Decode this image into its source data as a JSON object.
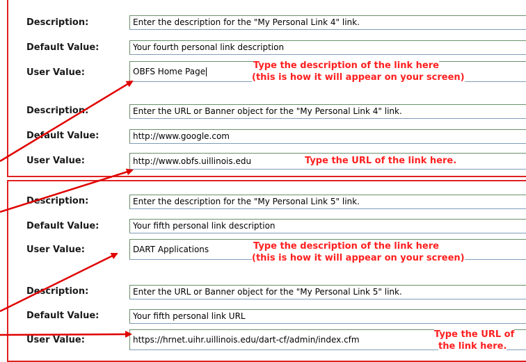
{
  "labels": {
    "description": "Description:",
    "default_value": "Default Value:",
    "user_value": "User Value:"
  },
  "link4": {
    "name_description": "Enter the description for the \"My Personal Link 4\" link.",
    "name_default": "Your fourth personal link description",
    "name_user": "OBFS Home Page",
    "url_description": "Enter the URL or Banner object for the \"My Personal Link 4\" link.",
    "url_default": "http://www.google.com",
    "url_user": "http://www.obfs.uillinois.edu"
  },
  "link5": {
    "name_description": "Enter the description for the \"My Personal Link 5\" link.",
    "name_default": "Your fifth personal link description",
    "name_user": "DART Applications",
    "url_description": "Enter the URL or Banner object for the \"My Personal Link 5\" link.",
    "url_default": "Your fifth personal link URL",
    "url_user": "https://hrnet.uihr.uillinois.edu/dart-cf/admin/index.cfm"
  },
  "notes": {
    "desc_line1": "Type the description of the link here",
    "desc_line2": "(this is how it will appear on your screen)",
    "url_here": "Type the URL of the link here.",
    "url_of_line1": "Type the URL of",
    "url_of_line2": "the link here."
  },
  "colors": {
    "panel_border": "#e02020",
    "annotation": "#ff2020",
    "arrow": "#e00000"
  }
}
